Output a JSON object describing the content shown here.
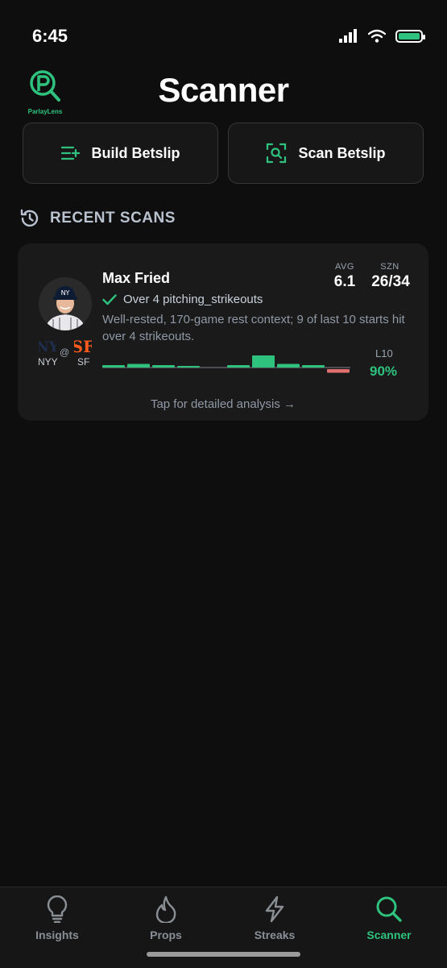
{
  "status": {
    "time": "6:45"
  },
  "app": {
    "logo_text": "ParlayLens",
    "title": "Scanner"
  },
  "actions": {
    "build_label": "Build Betslip",
    "scan_label": "Scan Betslip"
  },
  "recent": {
    "title": "RECENT SCANS"
  },
  "scan": {
    "player": "Max Fried",
    "pick": "Over 4 pitching_strikeouts",
    "context": "Well-rested, 170-game rest context; 9 of last 10 starts hit over 4 strikeouts.",
    "away_team": "NYY",
    "at": "@",
    "home_team": "SF",
    "avg_label": "AVG",
    "avg_value": "6.1",
    "szn_label": "SZN",
    "szn_value": "26/34",
    "l10_label": "L10",
    "l10_value": "90%",
    "hint": "Tap for detailed analysis →",
    "last10_margins": [
      1,
      1.5,
      1,
      0.5,
      0,
      1,
      5,
      1.5,
      1,
      -1.5
    ],
    "colors": {
      "hit": "#2ec27e",
      "miss": "#e07070"
    }
  },
  "nav": {
    "items": [
      {
        "label": "Insights",
        "icon": "lightbulb-icon"
      },
      {
        "label": "Props",
        "icon": "flame-icon"
      },
      {
        "label": "Streaks",
        "icon": "lightning-icon"
      },
      {
        "label": "Scanner",
        "icon": "search-icon",
        "active": true
      }
    ]
  },
  "colors": {
    "accent": "#2ec27e",
    "background": "#0e0e0e",
    "card": "#1a1a1a"
  }
}
